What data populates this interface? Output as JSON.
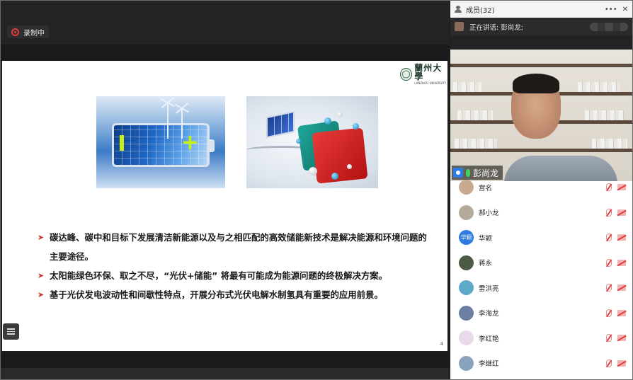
{
  "recording": {
    "label": "录制中"
  },
  "slide": {
    "logo": {
      "cn": "蘭州大學",
      "en": "LANZHOU UNIVERSITY"
    },
    "bullets": [
      "碳达峰、碳中和目标下发展清洁新能源以及与之相匹配的高效储能新技术是解决能源和环境问题的主要途径。",
      "太阳能绿色环保、取之不尽，“光伏+储能” 将最有可能成为能源问题的终极解决方案。",
      "基于光伏发电波动性和间歇性特点，开展分布式光伏电解水制氢具有重要的应用前景。"
    ],
    "page_number": "4"
  },
  "panel": {
    "title": "成员(32)",
    "more": "•••",
    "close": "✕",
    "speaking_label": "正在讲话: 彭尚龙;",
    "video_name": "彭尚龙",
    "members": [
      {
        "name": "宫名",
        "avatar_text": "",
        "avatar_color": "#c9a98f"
      },
      {
        "name": "郝小龙",
        "avatar_text": "",
        "avatar_color": "#b3aa9c"
      },
      {
        "name": "华颖",
        "avatar_text": "华颖",
        "avatar_color": "#2d7be0"
      },
      {
        "name": "蒋永",
        "avatar_text": "",
        "avatar_color": "#4c5a46"
      },
      {
        "name": "雷洪亮",
        "avatar_text": "",
        "avatar_color": "#5ea9c9"
      },
      {
        "name": "李海龙",
        "avatar_text": "",
        "avatar_color": "#6a7fa3"
      },
      {
        "name": "李红艳",
        "avatar_text": "",
        "avatar_color": "#e9d9e9"
      },
      {
        "name": "李继红",
        "avatar_text": "",
        "avatar_color": "#8aa3bd"
      }
    ]
  }
}
